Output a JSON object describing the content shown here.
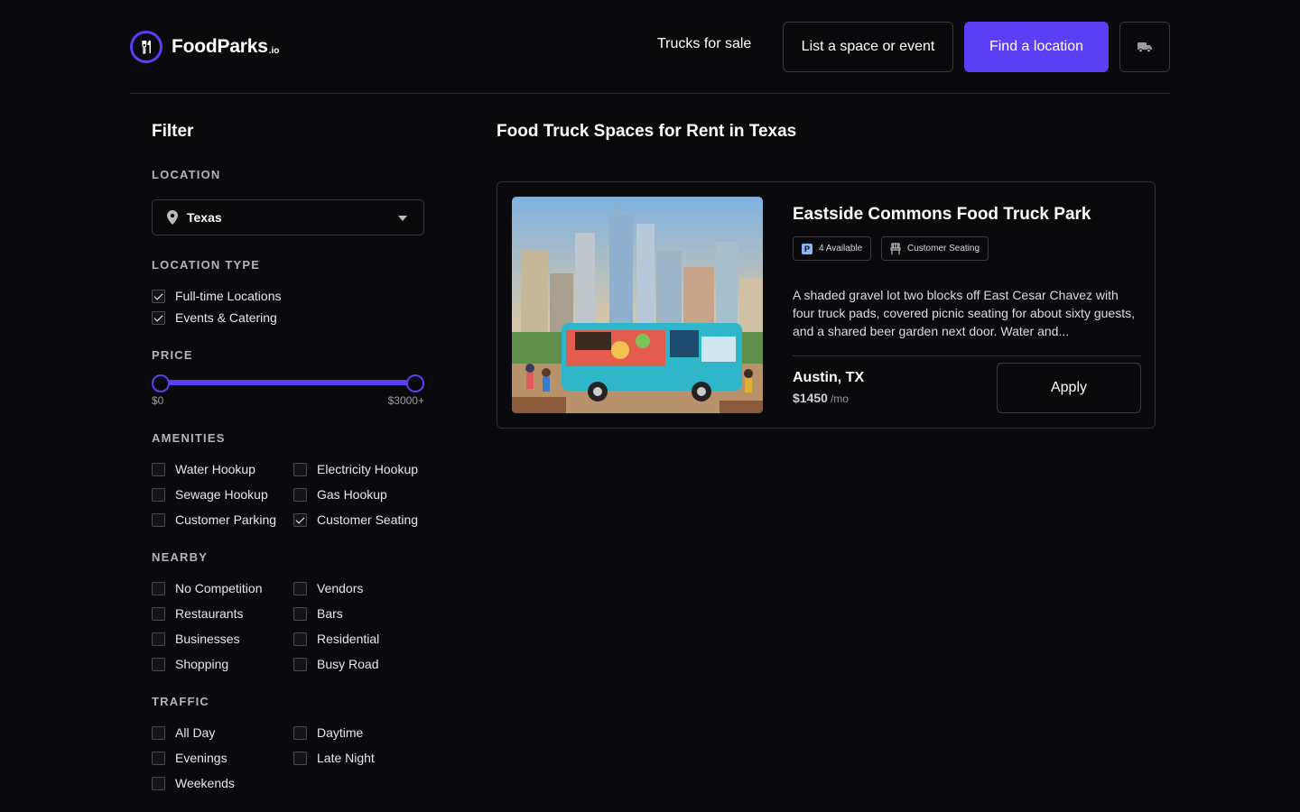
{
  "header": {
    "logo_text": "FoodParks",
    "logo_tld": ".io",
    "nav_trucks": "Trucks for sale",
    "btn_list": "List a space or event",
    "btn_find": "Find a location",
    "truck_icon": "truck-icon"
  },
  "colors": {
    "accent": "#5b3ff5",
    "background": "#0a0a0c",
    "border": "#3a3a40"
  },
  "filter": {
    "title": "Filter",
    "location": {
      "label": "LOCATION",
      "value": "Texas",
      "icon": "map-pin-icon"
    },
    "location_type": {
      "label": "LOCATION TYPE",
      "options": [
        {
          "label": "Full-time Locations",
          "checked": true
        },
        {
          "label": "Events & Catering",
          "checked": true
        }
      ]
    },
    "price": {
      "label": "PRICE",
      "min_label": "$0",
      "max_label": "$3000+",
      "min": 0,
      "max": 3000
    },
    "amenities": {
      "label": "AMENITIES",
      "options": [
        {
          "label": "Water Hookup",
          "checked": false
        },
        {
          "label": "Electricity Hookup",
          "checked": false
        },
        {
          "label": "Sewage Hookup",
          "checked": false
        },
        {
          "label": "Gas Hookup",
          "checked": false
        },
        {
          "label": "Customer Parking",
          "checked": false
        },
        {
          "label": "Customer Seating",
          "checked": true
        }
      ]
    },
    "nearby": {
      "label": "NEARBY",
      "options": [
        {
          "label": "No Competition",
          "checked": false
        },
        {
          "label": "Vendors",
          "checked": false
        },
        {
          "label": "Restaurants",
          "checked": false
        },
        {
          "label": "Bars",
          "checked": false
        },
        {
          "label": "Businesses",
          "checked": false
        },
        {
          "label": "Residential",
          "checked": false
        },
        {
          "label": "Shopping",
          "checked": false
        },
        {
          "label": "Busy Road",
          "checked": false
        }
      ]
    },
    "traffic": {
      "label": "TRAFFIC",
      "options": [
        {
          "label": "All Day",
          "checked": false
        },
        {
          "label": "Daytime",
          "checked": false
        },
        {
          "label": "Evenings",
          "checked": false
        },
        {
          "label": "Late Night",
          "checked": false
        },
        {
          "label": "Weekends",
          "checked": false
        }
      ]
    }
  },
  "main": {
    "title": "Food Truck Spaces for Rent in Texas",
    "listings": [
      {
        "name": "Eastside Commons Food Truck Park",
        "badge_available": "4 Available",
        "badge_seating": "Customer Seating",
        "description": "A shaded gravel lot two blocks off East Cesar Chavez with four truck pads, covered picnic seating for about sixty guests, and a shared beer garden next door. Water and...",
        "city": "Austin, TX",
        "price": "$1450",
        "price_unit": "/mo",
        "apply_label": "Apply"
      }
    ]
  }
}
